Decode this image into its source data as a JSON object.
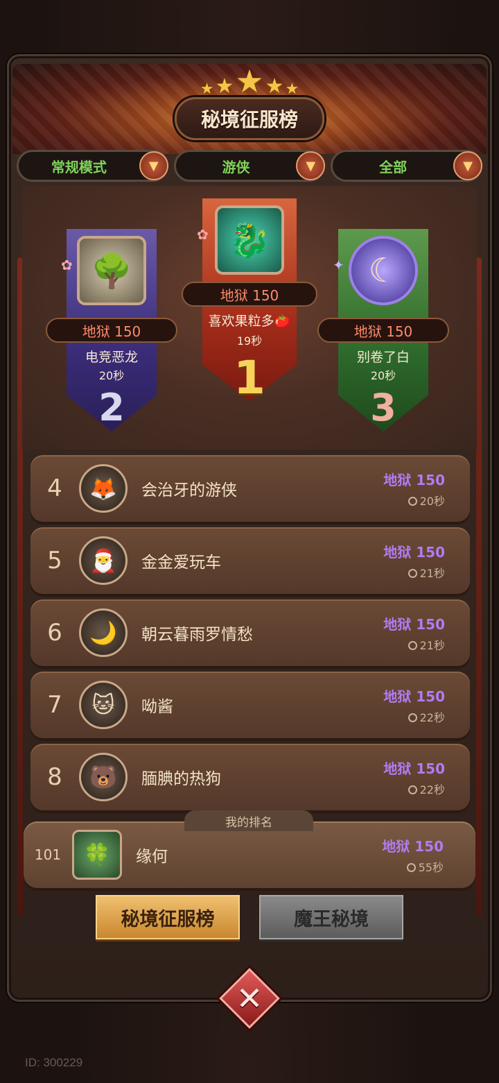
{
  "header": {
    "title": "秘境征服榜",
    "stars": 5
  },
  "filters": [
    {
      "label": "常规模式"
    },
    {
      "label": "游侠"
    },
    {
      "label": "全部"
    }
  ],
  "podium": {
    "first": {
      "level": "地狱 150",
      "name": "喜欢果粒多🍅",
      "time": "19秒",
      "rank": "1"
    },
    "second": {
      "level": "地狱 150",
      "name": "电竞恶龙",
      "time": "20秒",
      "rank": "2"
    },
    "third": {
      "level": "地狱 150",
      "name": "别卷了白",
      "time": "20秒",
      "rank": "3"
    }
  },
  "list": [
    {
      "rank": "4",
      "name": "会治牙的游侠",
      "level": "地狱 150",
      "time": "20秒",
      "avatar_icon": "🦊"
    },
    {
      "rank": "5",
      "name": "金金爱玩车",
      "level": "地狱 150",
      "time": "21秒",
      "avatar_icon": "🎅"
    },
    {
      "rank": "6",
      "name": "朝云暮雨罗情愁",
      "level": "地狱 150",
      "time": "21秒",
      "avatar_icon": "🌙"
    },
    {
      "rank": "7",
      "name": "呦酱",
      "level": "地狱 150",
      "time": "22秒",
      "avatar_icon": "🐱"
    },
    {
      "rank": "8",
      "name": "腼腆的热狗",
      "level": "地狱 150",
      "time": "22秒",
      "avatar_icon": "🐻"
    }
  ],
  "my_rank": {
    "tag": "我的排名",
    "rank": "101",
    "name": "缘何",
    "level": "地狱 150",
    "time": "55秒"
  },
  "tabs": {
    "active": "秘境征服榜",
    "inactive": "魔王秘境"
  },
  "footer": {
    "id": "ID: 300229"
  },
  "colors": {
    "level_purple": "#b07cf0",
    "filter_green": "#7fd35a",
    "gold": "#f7c44a"
  }
}
